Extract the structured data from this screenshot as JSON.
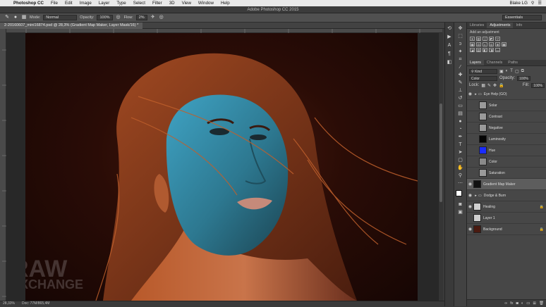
{
  "menubar": {
    "app_name": "Photoshop CC",
    "items": [
      "File",
      "Edit",
      "Image",
      "Layer",
      "Type",
      "Select",
      "Filter",
      "3D",
      "View",
      "Window",
      "Help"
    ],
    "user": "Blake LG"
  },
  "window": {
    "title": "Adobe Photoshop CC 2015"
  },
  "options_bar": {
    "mode_label": "Mode:",
    "mode_value": "Normal",
    "opacity_label": "Opacity:",
    "opacity_value": "100%",
    "flow_label": "Flow:",
    "flow_value": "2%",
    "workspace": "Essentials"
  },
  "document": {
    "tab_title": "2-20160607_mini16874.psd @ 28,3% (Gradient Map Maker, Layer Mask/16) *",
    "status_zoom": "28,33%",
    "status_doc": "Doc: 77M/865,4M"
  },
  "watermark": {
    "line1": "RAW",
    "line2": "EXCHANGE"
  },
  "adjustments_panel": {
    "tabs": [
      "Libraries",
      "Adjustments",
      "Info"
    ],
    "active_tab": "Adjustments",
    "add_label": "Add an adjustment"
  },
  "layers_panel": {
    "tabs": [
      "Layers",
      "Channels",
      "Paths"
    ],
    "active_tab": "Layers",
    "filter_kind": "Kind",
    "blend_mode": "Color",
    "opacity_label": "Opacity:",
    "opacity_value": "100%",
    "lock_label": "Lock:",
    "fill_label": "Fill:",
    "fill_value": "100%",
    "layers": [
      {
        "name": "Eye Help (GO)",
        "type": "group",
        "visible": true,
        "thumb": "#7a7a7a",
        "indent": 0
      },
      {
        "name": "Solar",
        "type": "adjustment",
        "visible": false,
        "thumb": "#9a9a9a",
        "indent": 1
      },
      {
        "name": "Contrast",
        "type": "adjustment",
        "visible": false,
        "thumb": "#9a9a9a",
        "indent": 1
      },
      {
        "name": "Negative",
        "type": "adjustment",
        "visible": false,
        "thumb": "#9a9a9a",
        "indent": 1
      },
      {
        "name": "Luminosity",
        "type": "fill",
        "visible": false,
        "thumb": "#050505",
        "indent": 1
      },
      {
        "name": "Hue",
        "type": "fill",
        "visible": false,
        "thumb": "#1a2cff",
        "indent": 1
      },
      {
        "name": "Color",
        "type": "fill",
        "visible": false,
        "thumb": "#8a8a8a",
        "indent": 1
      },
      {
        "name": "Saturation",
        "type": "adjustment",
        "visible": false,
        "thumb": "#9a9a9a",
        "indent": 1
      },
      {
        "name": "Gradient Map Maker",
        "type": "adjustment",
        "visible": true,
        "thumb": "#111111",
        "indent": 0,
        "selected": true
      },
      {
        "name": "Dodge & Burn",
        "type": "group",
        "visible": true,
        "thumb": "#7a7a7a",
        "indent": 0
      },
      {
        "name": "Healing",
        "type": "pixel",
        "visible": true,
        "thumb": "#cfcfcf",
        "indent": 0,
        "locked": true
      },
      {
        "name": "Layer 1",
        "type": "pixel",
        "visible": false,
        "thumb": "#cfcfcf",
        "indent": 0
      },
      {
        "name": "Background",
        "type": "pixel",
        "visible": true,
        "thumb": "#4a1a10",
        "indent": 0,
        "locked": true
      }
    ]
  }
}
